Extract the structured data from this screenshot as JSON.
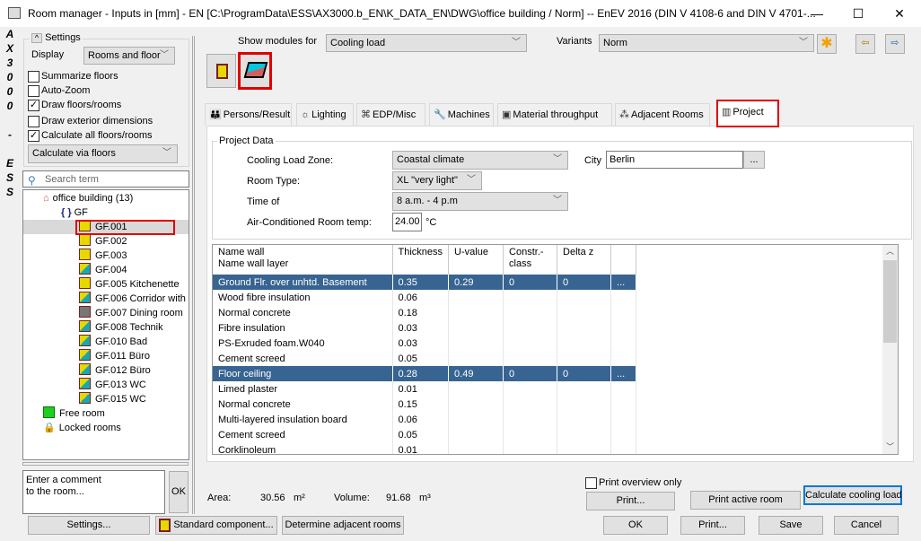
{
  "window": {
    "title": "Room manager - Inputs in [mm] - EN [C:\\ProgramData\\ESS\\AX3000.b_EN\\K_DATA_EN\\DWG\\office building / Norm] -- EnEV 2016 (DIN V 4108-6 and DIN V 4701-...",
    "minimize": "—",
    "maximize": "☐",
    "close": "✕"
  },
  "brand_strip": [
    "A",
    "X",
    "3",
    "0",
    "0",
    "0",
    "",
    "-",
    "",
    "E",
    "S",
    "S"
  ],
  "settings": {
    "label": "Settings",
    "display_label": "Display",
    "display_value": "Rooms and floor",
    "checkboxes": [
      {
        "label": "Summarize floors",
        "checked": false
      },
      {
        "label": "Auto-Zoom",
        "checked": false
      },
      {
        "label": "Draw floors/rooms",
        "checked": true
      },
      {
        "label": "Draw exterior dimensions",
        "checked": false
      },
      {
        "label": "Calculate all floors/rooms",
        "checked": true
      }
    ],
    "calc_value": "Calculate via floors"
  },
  "search": {
    "placeholder": "Search term"
  },
  "tree": {
    "root": "office building (13)",
    "floor": "GF",
    "rooms": [
      {
        "label": "GF.001",
        "type": "yellow",
        "selected": true
      },
      {
        "label": "GF.002",
        "type": "yellow"
      },
      {
        "label": "GF.003",
        "type": "yellow"
      },
      {
        "label": "GF.004",
        "type": "teal"
      },
      {
        "label": "GF.005 Kitchenette",
        "type": "yellow"
      },
      {
        "label": "GF.006 Corridor with",
        "type": "teal"
      },
      {
        "label": "GF.007 Dining room",
        "type": "gray"
      },
      {
        "label": "GF.008 Technik",
        "type": "teal"
      },
      {
        "label": "GF.010 Bad",
        "type": "teal"
      },
      {
        "label": "GF.011 Büro",
        "type": "teal"
      },
      {
        "label": "GF.012 Büro",
        "type": "teal"
      },
      {
        "label": "GF.013 WC",
        "type": "teal"
      },
      {
        "label": "GF.015 WC",
        "type": "teal"
      }
    ],
    "free": "Free room",
    "locked": "Locked rooms"
  },
  "comment": {
    "text": "Enter a comment\nto the room...",
    "ok": "OK"
  },
  "left_buttons": {
    "settings": "Settings...",
    "standard": "Standard component...",
    "adjacent": "Determine adjacent rooms"
  },
  "top": {
    "show_modules_label": "Show modules for",
    "show_modules_value": "Cooling load",
    "variants_label": "Variants",
    "variants_value": "Norm"
  },
  "tabs": [
    {
      "label": "Persons/Result",
      "icon": "persons-icon"
    },
    {
      "label": "Lighting",
      "icon": "bulb-icon"
    },
    {
      "label": "EDP/Misc",
      "icon": "edp-icon"
    },
    {
      "label": "Machines",
      "icon": "wrench-icon"
    },
    {
      "label": "Material throughput",
      "icon": "monitor-icon"
    },
    {
      "label": "Adjacent Rooms",
      "icon": "adjacent-icon"
    },
    {
      "label": "Project",
      "icon": "chart-icon",
      "active": true
    }
  ],
  "project": {
    "group": "Project Data",
    "zone_label": "Cooling Load Zone:",
    "zone_value": "Coastal climate",
    "city_label": "City",
    "city_value": "Berlin",
    "city_btn": "...",
    "roomtype_label": "Room Type:",
    "roomtype_value": "XL \"very light\"",
    "time_label": "Time of",
    "time_value": "8 a.m. - 4 p.m",
    "temp_label": "Air-Conditioned Room temp:",
    "temp_value": "24.00",
    "temp_unit": "°C"
  },
  "table": {
    "headers": [
      "Name wall\nName wall layer",
      "Thickness",
      "U-value",
      "Constr.-\nclass",
      "Delta z",
      ""
    ],
    "rows": [
      {
        "c": [
          "Ground Flr. over unhtd. Basement",
          "0.35",
          "0.29",
          "0",
          "0",
          "..."
        ],
        "hl": true
      },
      {
        "c": [
          "Wood fibre insulation",
          "0.06",
          "",
          "",
          "",
          ""
        ]
      },
      {
        "c": [
          "Normal concrete",
          "0.18",
          "",
          "",
          "",
          ""
        ]
      },
      {
        "c": [
          "Fibre insulation",
          "0.03",
          "",
          "",
          "",
          ""
        ]
      },
      {
        "c": [
          "PS-Exruded foam.W040",
          "0.03",
          "",
          "",
          "",
          ""
        ]
      },
      {
        "c": [
          "Cement screed",
          "0.05",
          "",
          "",
          "",
          ""
        ]
      },
      {
        "c": [
          "Floor ceiling",
          "0.28",
          "0.49",
          "0",
          "0",
          "..."
        ],
        "hl": true
      },
      {
        "c": [
          "Limed plaster",
          "0.01",
          "",
          "",
          "",
          ""
        ]
      },
      {
        "c": [
          "Normal concrete",
          "0.15",
          "",
          "",
          "",
          ""
        ]
      },
      {
        "c": [
          "Multi-layered insulation board",
          "0.06",
          "",
          "",
          "",
          ""
        ]
      },
      {
        "c": [
          "Cement screed",
          "0.05",
          "",
          "",
          "",
          ""
        ]
      },
      {
        "c": [
          "Corklinoleum",
          "0.01",
          "",
          "",
          "",
          ""
        ]
      }
    ]
  },
  "stats": {
    "area_label": "Area:",
    "area_value": "30.56",
    "area_unit": "m²",
    "volume_label": "Volume:",
    "volume_value": "91.68",
    "volume_unit": "m³"
  },
  "bottom": {
    "print_overview": "Print overview only",
    "print": "Print...",
    "print_active": "Print active room",
    "calc_cooling": "Calculate cooling load",
    "ok": "OK",
    "print2": "Print...",
    "save": "Save",
    "cancel": "Cancel"
  },
  "colors": {
    "selection": "#376491",
    "highlight_border": "#e00000",
    "focus_border": "#0078d7"
  }
}
